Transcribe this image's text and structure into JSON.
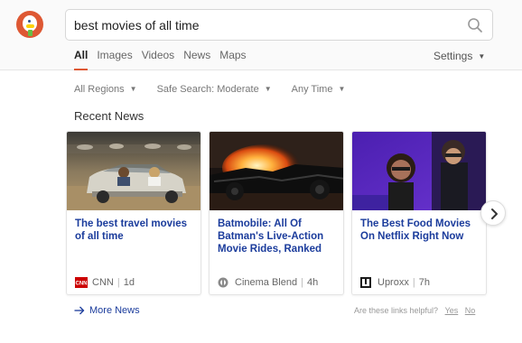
{
  "search": {
    "query": "best movies of all time"
  },
  "tabs": [
    {
      "label": "All",
      "active": true
    },
    {
      "label": "Images"
    },
    {
      "label": "Videos"
    },
    {
      "label": "News"
    },
    {
      "label": "Maps"
    }
  ],
  "settings_label": "Settings",
  "filters": [
    "All Regions",
    "Safe Search: Moderate",
    "Any Time"
  ],
  "section_title": "Recent News",
  "cards": [
    {
      "title": "The best travel movies of all time",
      "source": "CNN",
      "age": "1d"
    },
    {
      "title": "Batmobile: All Of Batman's Live-Action Movie Rides, Ranked",
      "source": "Cinema Blend",
      "age": "4h"
    },
    {
      "title": "The Best Food Movies On Netflix Right Now",
      "source": "Uproxx",
      "age": "7h"
    }
  ],
  "more_news_label": "More News",
  "helpful": {
    "question": "Are these links helpful?",
    "yes": "Yes",
    "no": "No"
  },
  "colors": {
    "accent": "#de5833",
    "link": "#1b3c9c"
  },
  "source_icons": [
    "cnn-logo-icon",
    "cinema-blend-logo-icon",
    "uproxx-logo-icon"
  ]
}
